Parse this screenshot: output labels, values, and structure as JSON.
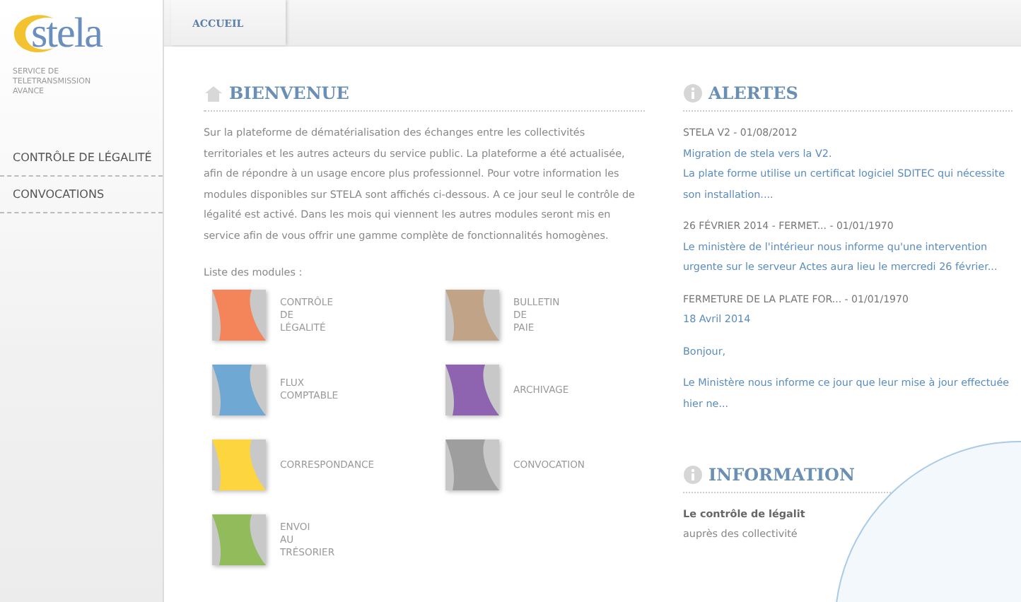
{
  "logo": {
    "text": "stela",
    "subtitle": "SERVICE DE TELETRANSMISSION AVANCE"
  },
  "sidebar": {
    "items": [
      {
        "label": "CONTRÔLE DE LÉGALITÉ"
      },
      {
        "label": "CONVOCATIONS"
      }
    ]
  },
  "tabs": [
    {
      "label": "ACCUEIL",
      "selected": true
    }
  ],
  "welcome": {
    "title": "BIENVENUE",
    "text": "Sur la plateforme de dématérialisation des échanges entre les collectivités territoriales et les autres acteurs du service public. La plateforme a été actualisée, afin de répondre à un usage encore plus professionnel. Pour votre information les modules disponibles sur STELA sont affichés ci-dessous. A ce jour seul le contrôle de légalité est activé. Dans les mois qui viennent les autres modules seront mis en service afin de vous offrir une gamme complète de fonctionnalités homogènes.",
    "modules_label": "Liste des modules :",
    "modules": [
      {
        "lines": [
          "CONTRÔLE",
          "DE",
          "LÉGALITÉ"
        ],
        "color": "#f4845a"
      },
      {
        "lines": [
          "BULLETIN",
          "DE",
          "PAIE"
        ],
        "color": "#c1a387"
      },
      {
        "lines": [
          "FLUX",
          "COMPTABLE"
        ],
        "color": "#6fa8d2"
      },
      {
        "lines": [
          "ARCHIVAGE"
        ],
        "color": "#8e63b0"
      },
      {
        "lines": [
          "CORRESPONDANCE"
        ],
        "color": "#fcd53f"
      },
      {
        "lines": [
          "CONVOCATION"
        ],
        "color": "#9e9e9e"
      },
      {
        "lines": [
          "ENVOI",
          "AU",
          "TRÉSORIER"
        ],
        "color": "#92bc5b"
      }
    ]
  },
  "alerts": {
    "title": "ALERTES",
    "items": [
      {
        "title": "STELA V2 - 01/08/2012",
        "lines": [
          "Migration de stela vers la V2.",
          "La plate forme utilise un certificat logiciel SDITEC qui nécessite son installation...."
        ]
      },
      {
        "title": "26 FÉVRIER 2014 - FERMET... - 01/01/1970",
        "lines": [
          "Le ministère de l'intérieur nous informe qu'une intervention urgente sur le serveur Actes aura lieu le mercredi 26 février..."
        ]
      },
      {
        "title": "FERMETURE DE LA PLATE FOR... - 01/01/1970",
        "lines": [
          "18 Avril 2014",
          "Bonjour,",
          "Le Ministère nous informe ce jour que leur mise à jour effectuée hier ne..."
        ]
      }
    ]
  },
  "information": {
    "title": "INFORMATION",
    "lead": "Le contrôle de légalit",
    "text": "auprès des collectivité"
  }
}
